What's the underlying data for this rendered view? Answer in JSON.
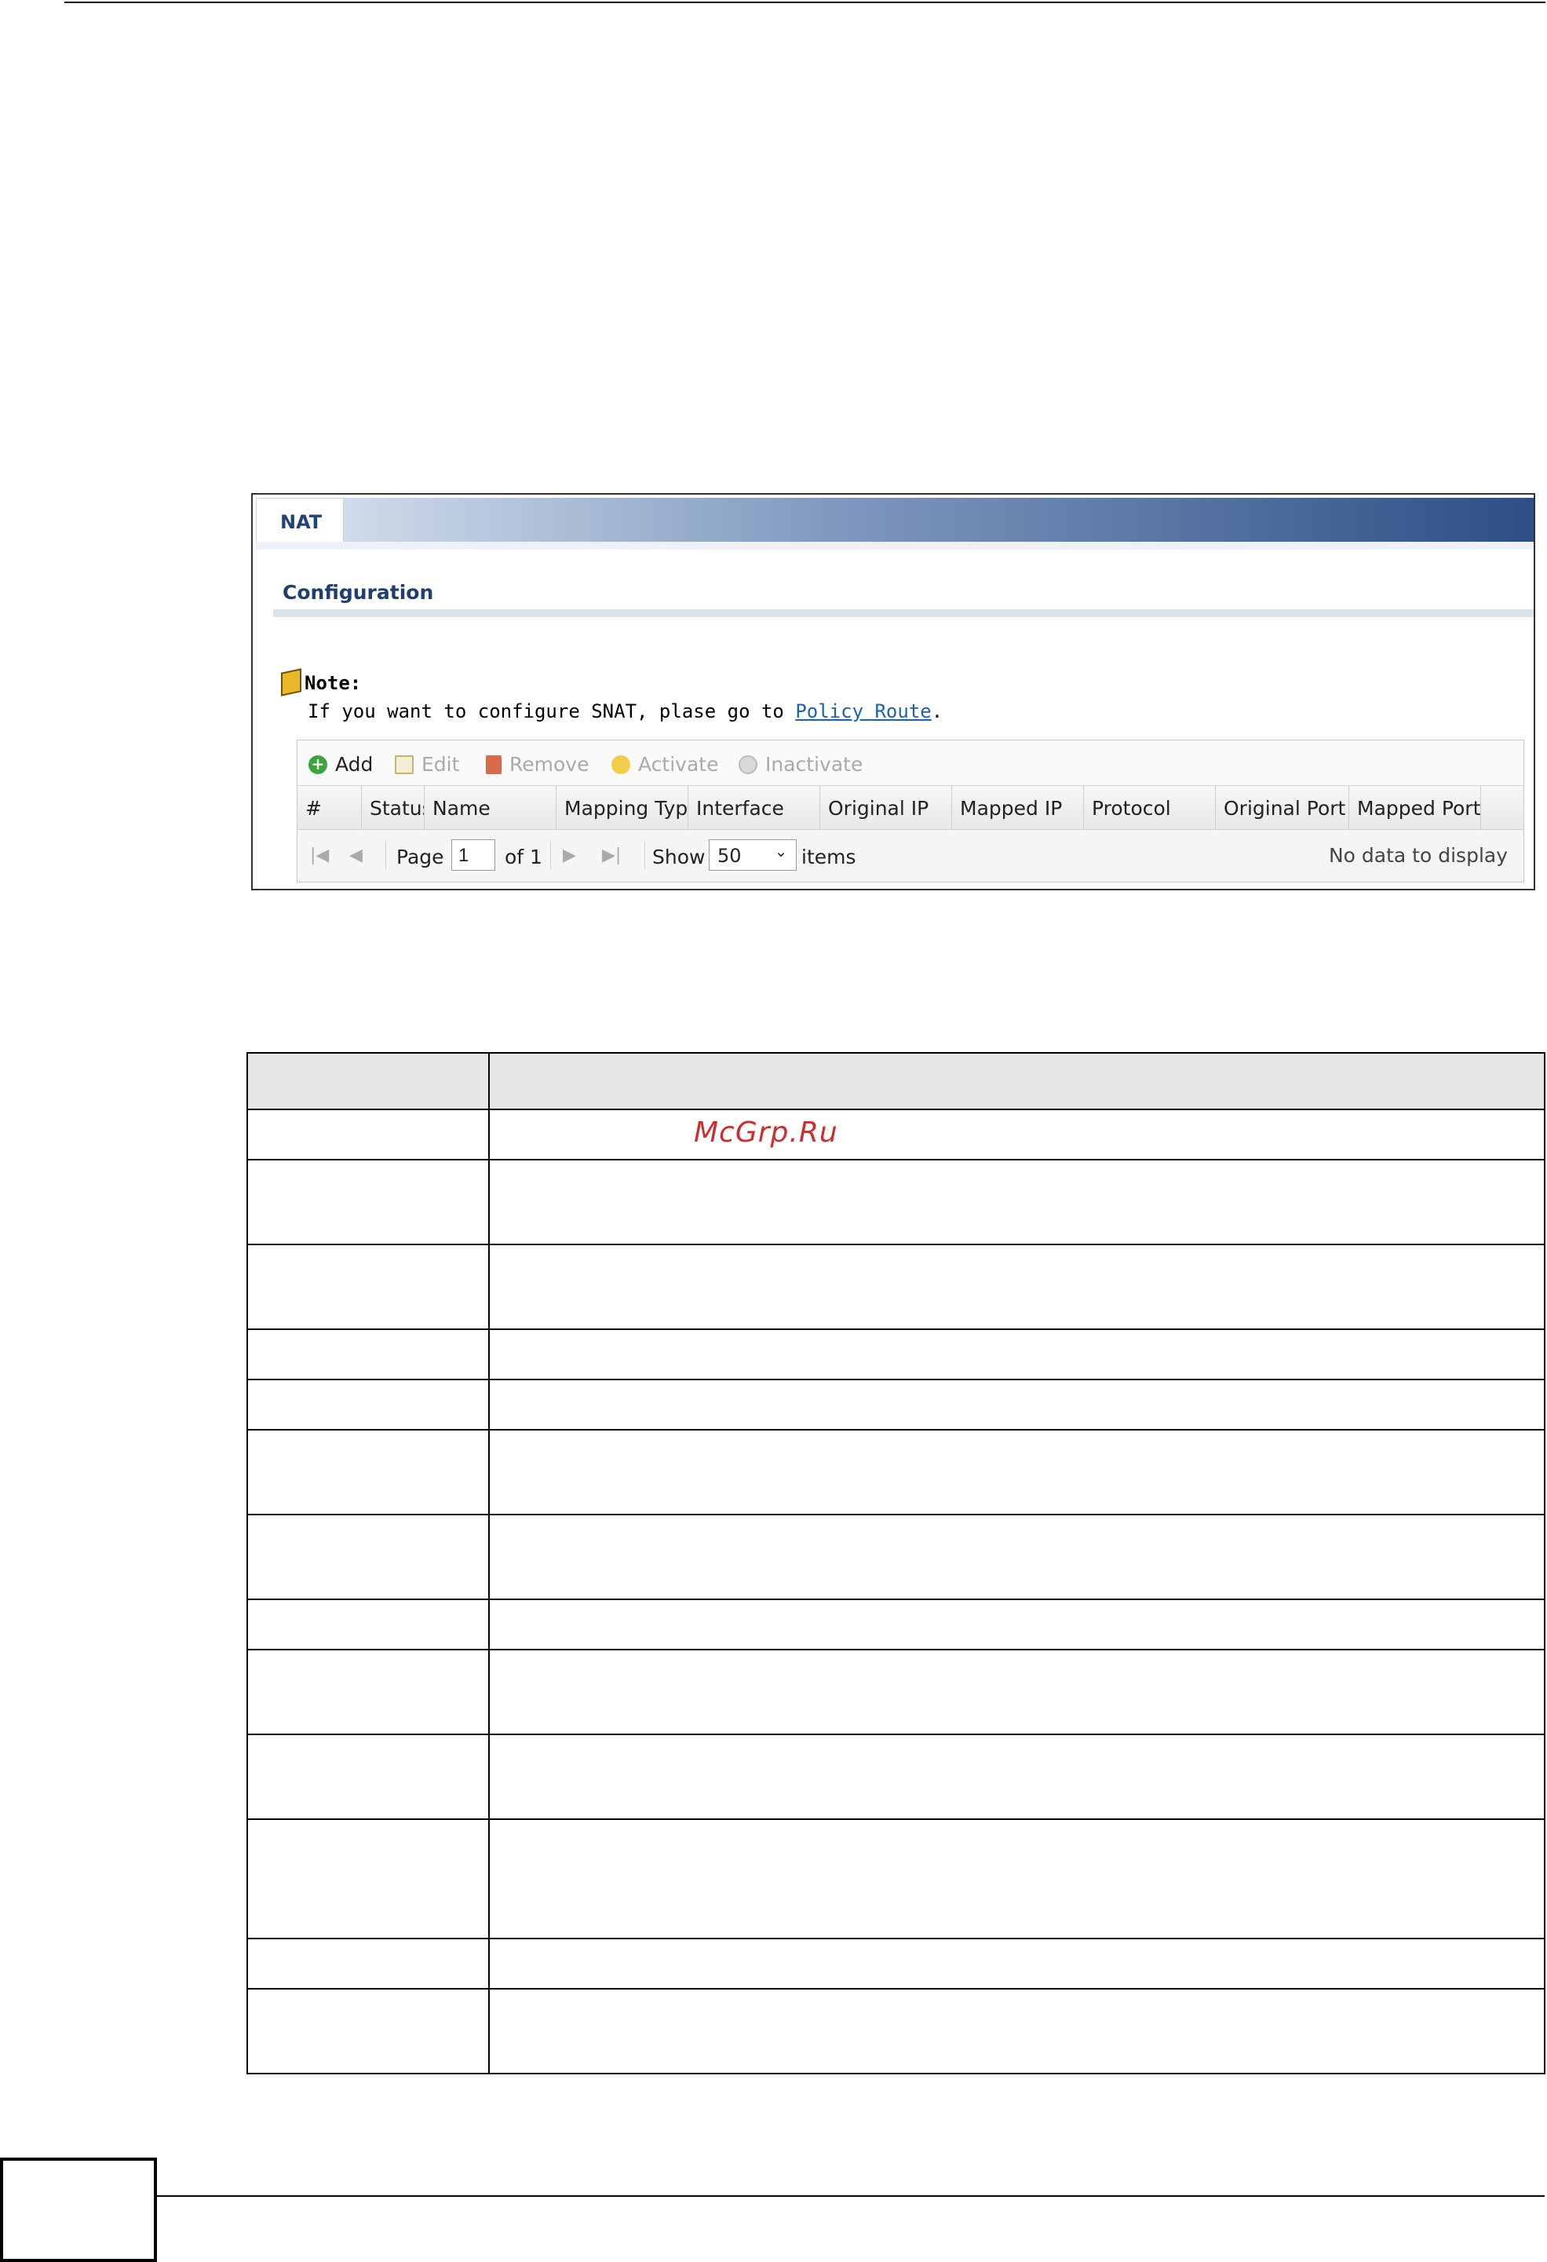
{
  "panel": {
    "tab_label": "NAT",
    "section_title": "Configuration",
    "note": {
      "heading": "Note:",
      "text_prefix": "If you want to configure SNAT, plase go to ",
      "link_text": "Policy Route",
      "text_suffix": "."
    },
    "toolbar": {
      "add": "Add",
      "edit": "Edit",
      "remove": "Remove",
      "activate": "Activate",
      "inactivate": "Inactivate"
    },
    "columns": [
      "#",
      "Status",
      "Name",
      "Mapping Type",
      "Interface",
      "Original IP",
      "Mapped IP",
      "Protocol",
      "Original Port",
      "Mapped Port"
    ],
    "pager": {
      "page_label": "Page",
      "page_value": "1",
      "of_label": "of 1",
      "show_label": "Show",
      "show_value": "50",
      "items_label": "items",
      "empty_message": "No data to display"
    }
  },
  "watermark": "McGrp.Ru",
  "icons": [
    "add-icon",
    "edit-icon",
    "remove-icon",
    "activate-icon",
    "inactivate-icon",
    "note-icon",
    "first-page-icon",
    "prev-page-icon",
    "next-page-icon",
    "last-page-icon",
    "chevron-down-icon"
  ]
}
